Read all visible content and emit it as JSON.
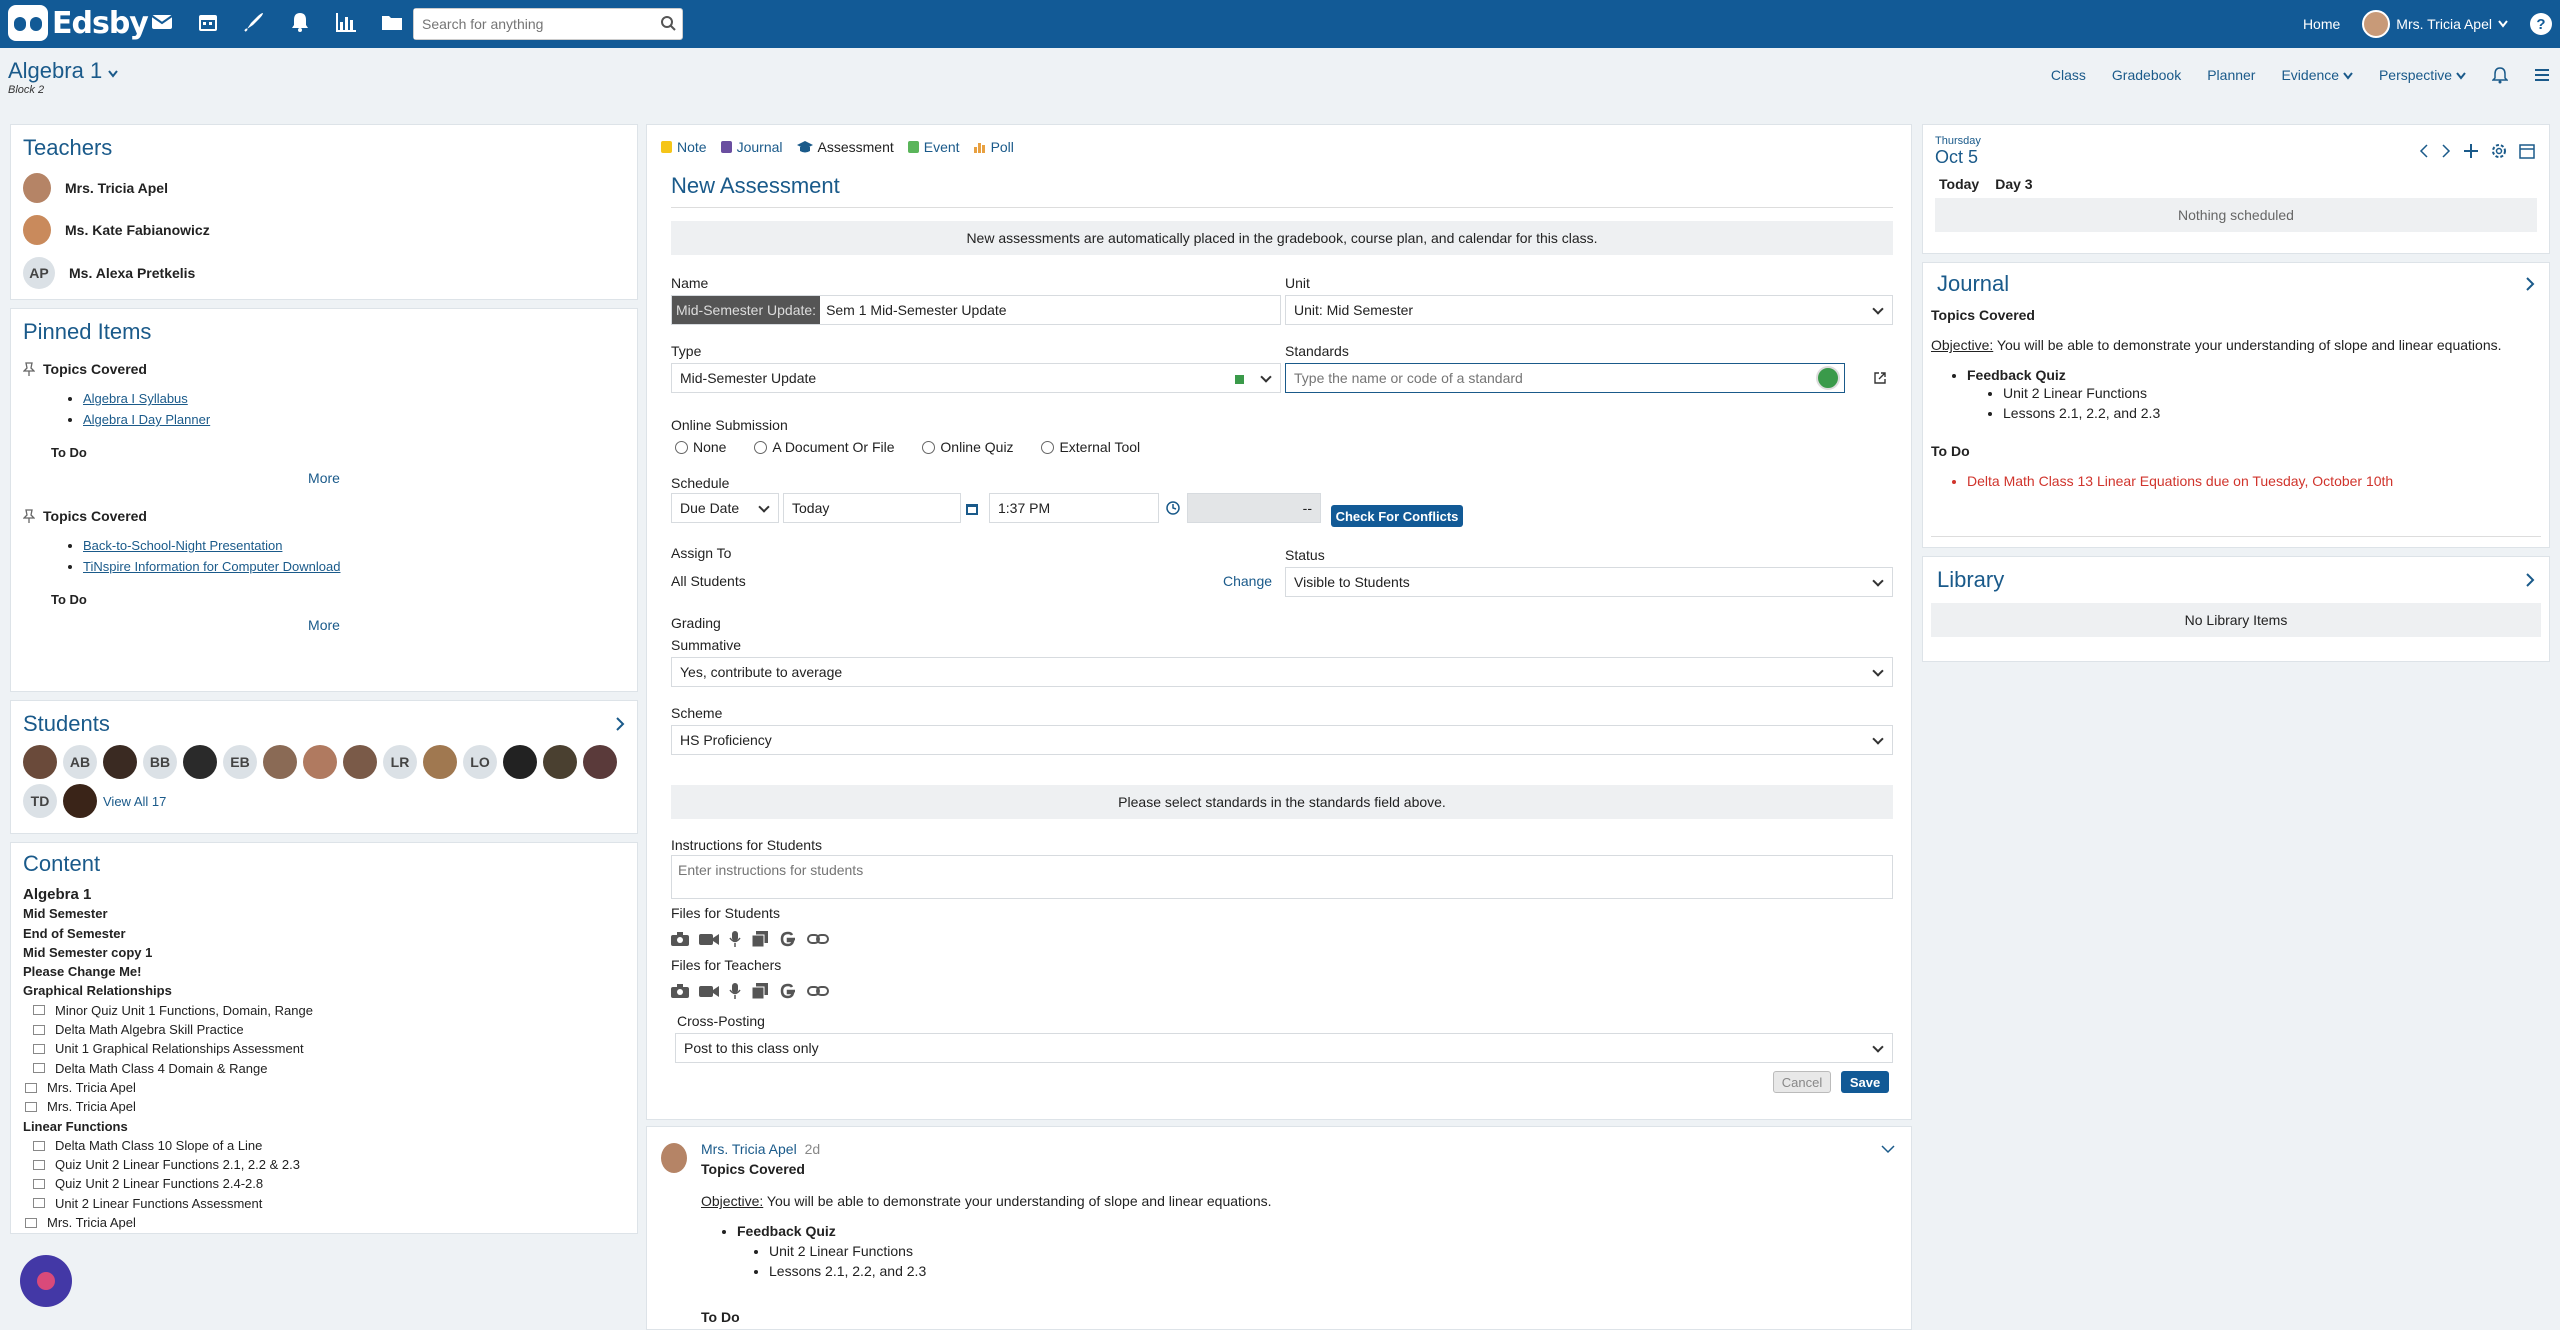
{
  "brand": "Edsby",
  "search": {
    "placeholder": "Search for anything"
  },
  "topbar": {
    "home": "Home",
    "user": "Mrs. Tricia Apel"
  },
  "class": {
    "title": "Algebra 1",
    "subtitle": "Block 2"
  },
  "classnav": [
    "Class",
    "Gradebook",
    "Planner",
    "Evidence",
    "Perspective"
  ],
  "teachers": {
    "title": "Teachers",
    "items": [
      {
        "name": "Mrs. Tricia Apel"
      },
      {
        "name": "Ms. Kate Fabianowicz"
      },
      {
        "name": "Ms. Alexa Pretkelis",
        "initials": "AP"
      }
    ]
  },
  "pinned": {
    "title": "Pinned Items",
    "groups": [
      {
        "heading": "Topics Covered",
        "links": [
          "Algebra I Syllabus",
          "Algebra I Day Planner"
        ],
        "todo": "To Do",
        "more": "More"
      },
      {
        "heading": "Topics Covered",
        "links": [
          "Back-to-School-Night Presentation",
          "TiNspire Information for Computer Download"
        ],
        "todo": "To Do",
        "more": "More"
      }
    ]
  },
  "students": {
    "title": "Students",
    "initials": [
      "AB",
      "BB",
      "EB",
      "LR",
      "LO",
      "TD"
    ],
    "view_all": "View All 17"
  },
  "content": {
    "title": "Content",
    "items": [
      {
        "text": "Algebra 1",
        "style": "top"
      },
      {
        "text": "Mid Semester",
        "style": "b"
      },
      {
        "text": "End of Semester",
        "style": "b"
      },
      {
        "text": "Mid Semester copy 1",
        "style": "b"
      },
      {
        "text": "Please Change Me!",
        "style": "b"
      },
      {
        "text": "Graphical Relationships",
        "style": "b"
      },
      {
        "text": "Minor Quiz Unit 1 Functions, Domain, Range",
        "style": "it"
      },
      {
        "text": "Delta Math Algebra Skill Practice",
        "style": "it"
      },
      {
        "text": "Unit 1 Graphical Relationships Assessment",
        "style": "it"
      },
      {
        "text": "Delta Math Class 4 Domain & Range",
        "style": "it"
      },
      {
        "text": "Mrs. Tricia Apel",
        "style": "doc"
      },
      {
        "text": "Mrs. Tricia Apel",
        "style": "doc"
      },
      {
        "text": "Linear Functions",
        "style": "b"
      },
      {
        "text": "Delta Math Class 10 Slope of a Line",
        "style": "it"
      },
      {
        "text": "Quiz Unit 2 Linear Functions 2.1, 2.2 & 2.3",
        "style": "it"
      },
      {
        "text": "Quiz Unit 2 Linear Functions 2.4-2.8",
        "style": "it"
      },
      {
        "text": "Unit 2 Linear Functions Assessment",
        "style": "it"
      },
      {
        "text": "Mrs. Tricia Apel",
        "style": "doc"
      }
    ]
  },
  "form": {
    "tabs": [
      "Note",
      "Journal",
      "Assessment",
      "Event",
      "Poll"
    ],
    "title": "New Assessment",
    "info": "New assessments are automatically placed in the gradebook, course plan, and calendar for this class.",
    "name_label": "Name",
    "name_prefix": "Mid-Semester Update:",
    "name_value": "Sem 1 Mid-Semester Update",
    "unit_label": "Unit",
    "unit_value": "Unit: Mid Semester",
    "type_label": "Type",
    "type_value": "Mid-Semester Update",
    "standards_label": "Standards",
    "standards_placeholder": "Type the name or code of a standard",
    "online_label": "Online Submission",
    "online_options": [
      "None",
      "A Document Or File",
      "Online Quiz",
      "External Tool"
    ],
    "schedule_label": "Schedule",
    "schedule_kind": "Due Date",
    "schedule_date": "Today",
    "schedule_time": "1:37 PM",
    "schedule_end": "--",
    "conflicts": "Check For Conflicts",
    "assign_label": "Assign To",
    "assign_value": "All Students",
    "change": "Change",
    "status_label": "Status",
    "status_value": "Visible to Students",
    "grading_label": "Grading",
    "summative_label": "Summative",
    "summative_value": "Yes, contribute to average",
    "scheme_label": "Scheme",
    "scheme_value": "HS Proficiency",
    "standards_info": "Please select standards in the standards field above.",
    "instructions_label": "Instructions for Students",
    "instructions_placeholder": "Enter instructions for students",
    "files_students": "Files for Students",
    "files_teachers": "Files for Teachers",
    "crosspost_label": "Cross-Posting",
    "crosspost_value": "Post to this class only",
    "cancel": "Cancel",
    "save": "Save"
  },
  "post": {
    "author": "Mrs. Tricia Apel",
    "time": "2d",
    "heading": "Topics Covered",
    "objective_label": "Objective:",
    "objective": "You will be able to demonstrate your understanding of slope and linear equations.",
    "item": "Feedback Quiz",
    "subitems": [
      "Unit 2 Linear Functions",
      "Lessons 2.1, 2.2, and 2.3"
    ],
    "todo": "To Do"
  },
  "calendar": {
    "weekday": "Thursday",
    "date": "Oct 5",
    "today": "Today",
    "day": "Day 3",
    "empty": "Nothing scheduled"
  },
  "journal": {
    "title": "Journal",
    "heading": "Topics Covered",
    "objective_label": "Objective:",
    "objective": "You will be able to demonstrate your understanding of slope and linear equations.",
    "item": "Feedback Quiz",
    "subitems": [
      "Unit 2 Linear Functions",
      "Lessons 2.1, 2.2, and 2.3"
    ],
    "todo": "To Do",
    "todo_item": "Delta Math Class 13 Linear Equations due on Tuesday, October 10th"
  },
  "library": {
    "title": "Library",
    "empty": "No Library Items"
  },
  "colors": {
    "brand": "#125a96",
    "link": "#1a5a8a",
    "due": "#d0342c"
  }
}
